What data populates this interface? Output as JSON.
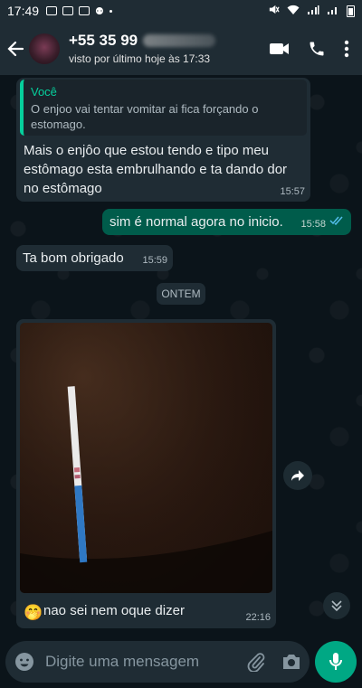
{
  "status_bar": {
    "time": "17:49"
  },
  "header": {
    "contact_name": "+55 35 99",
    "last_seen": "visto por último hoje às 17:33"
  },
  "messages": {
    "quoted": {
      "author": "Você",
      "text": "O enjoo vai tentar vomitar ai fica forçando o estomago.",
      "reply_text": "Mais o enjôo que estou tendo e tipo meu estômago esta embrulhando e ta dando dor no estômago",
      "time": "15:57"
    },
    "outgoing_1": {
      "text": "sim é normal agora no inicio.",
      "time": "15:58"
    },
    "incoming_2": {
      "text": "Ta bom obrigado",
      "time": "15:59"
    },
    "day_divider": "ONTEM",
    "image_message": {
      "caption_emoji": "🤭",
      "caption": "nao sei nem oque dizer",
      "time": "22:16"
    }
  },
  "input": {
    "placeholder": "Digite uma mensagem"
  },
  "colors": {
    "bar_bg": "#1f2c34",
    "chat_bg": "#0b141a",
    "incoming_bubble": "#1f2c34",
    "outgoing_bubble": "#005c4b",
    "accent": "#00a884",
    "read_tick": "#53bdeb"
  }
}
